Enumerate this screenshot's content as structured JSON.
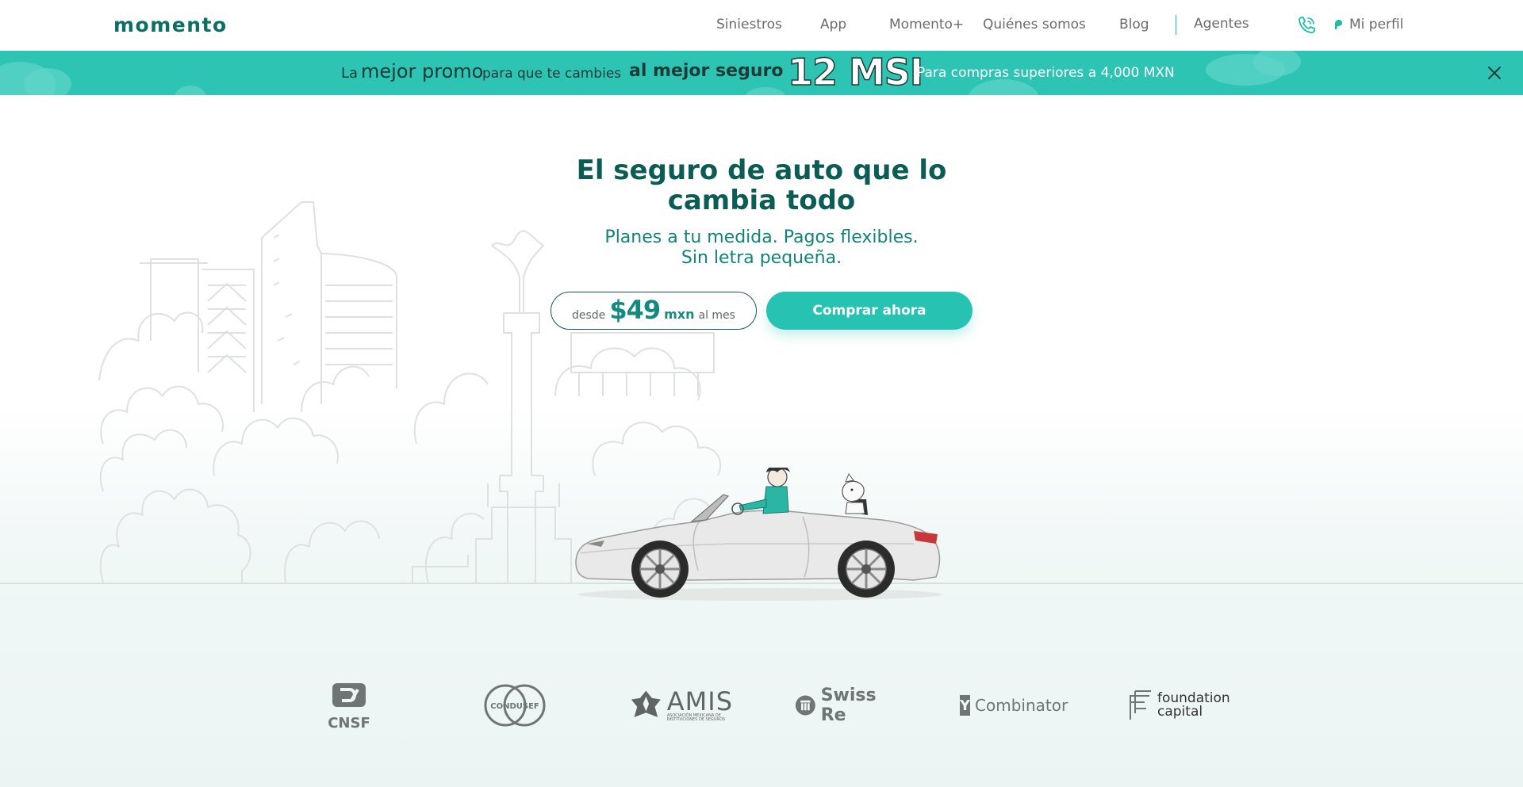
{
  "nav": {
    "logo": "momento",
    "links": [
      "Siniestros",
      "App",
      "Momento+",
      "Quiénes somos",
      "Blog",
      "Agentes"
    ],
    "profile_label": "Mi perfil",
    "accent": "#1bbfa8"
  },
  "promo": {
    "la": "La",
    "mejor_promo": "mejor promo",
    "para_que": "para que te cambies",
    "al_mejor_seguro": "al mejor seguro",
    "msi": "12 MSI",
    "condition": "Para compras superiores a 4,000 MXN",
    "background": "#2ec4b4"
  },
  "hero": {
    "title_line1": "El seguro de auto que lo",
    "title_line2": "cambia todo",
    "subtitle_line1": "Planes a tu medida. Pagos flexibles.",
    "subtitle_line2": "Sin letra pequeña.",
    "price": {
      "desde": "desde",
      "amount": "$49",
      "currency": "mxn",
      "period": "al mes"
    },
    "cta_label": "Comprar ahora",
    "cta_color": "#27c3b2"
  },
  "partners": {
    "cnsf": "CNSF",
    "condusef": "CONDUSEF",
    "amis": "AMIS",
    "amis_sub": "ASOCIACIÓN MEXICANA DE INSTITUCIONES DE SEGUROS",
    "swissre": "Swiss Re",
    "yc_letter": "Y",
    "yc": "Combinator",
    "foundation_line1": "foundation",
    "foundation_line2": "capital"
  },
  "icons": {
    "phone": "phone-icon",
    "profile": "profile-dot-icon",
    "close": "close-icon"
  }
}
